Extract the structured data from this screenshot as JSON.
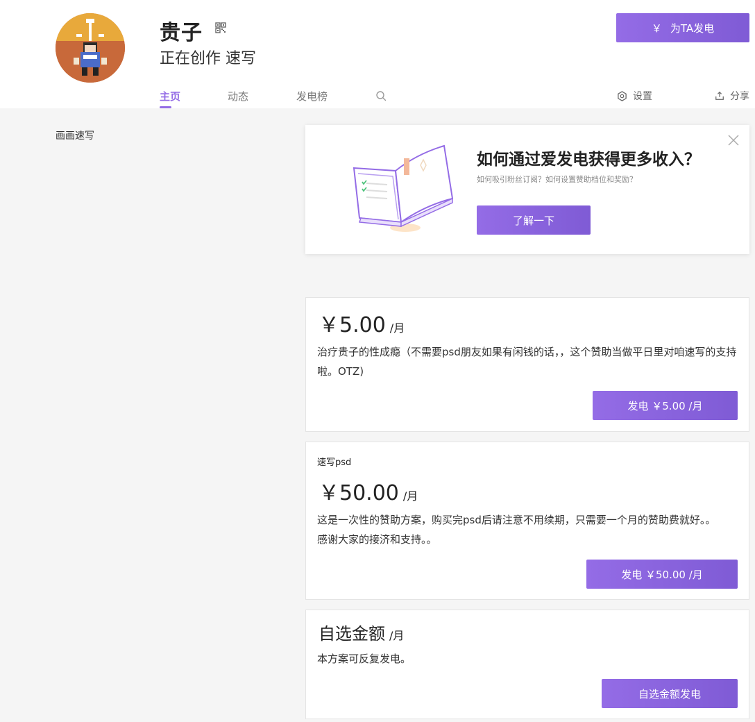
{
  "creator": {
    "name": "贵子",
    "description": "正在创作 速写"
  },
  "header": {
    "sponsor_symbol": "￥",
    "sponsor_label": "为TA发电",
    "tabs": [
      {
        "label": "主页",
        "active": true
      },
      {
        "label": "动态",
        "active": false
      },
      {
        "label": "发电榜",
        "active": false
      }
    ],
    "settings_label": "设置",
    "share_label": "分享"
  },
  "sidebar": {
    "about": "画画速写"
  },
  "promo": {
    "title": "如何通过爱发电获得更多收入？",
    "subtitle": "如何吸引粉丝订阅？如何设置赞助档位和奖励？",
    "button": "了解一下"
  },
  "plans": [
    {
      "name": "",
      "price": "￥5.00",
      "unit": "/月",
      "description": "治疗贵子的性成瘾（不需要psd朋友如果有闲钱的话，，这个赞助当做平日里对咱速写的支持啦。OTZ)",
      "button": "发电 ￥5.00 /月"
    },
    {
      "name": "速写psd",
      "price": "￥50.00",
      "unit": "/月",
      "description": "这是一次性的赞助方案，购买完psd后请注意不用续期，只需要一个月的赞助费就好。。感谢大家的接济和支持。。",
      "button": "发电 ￥50.00 /月"
    },
    {
      "name": "",
      "price": "自选金额",
      "unit": "/月",
      "description": "本方案可反复发电。",
      "button": "自选金额发电"
    }
  ],
  "colors": {
    "accent": "#946ce6",
    "accent_dark": "#7f5bd5",
    "background": "#f5f5f5"
  },
  "icons": [
    "qr-code-icon",
    "search-icon",
    "gear-icon",
    "share-icon",
    "close-icon"
  ]
}
